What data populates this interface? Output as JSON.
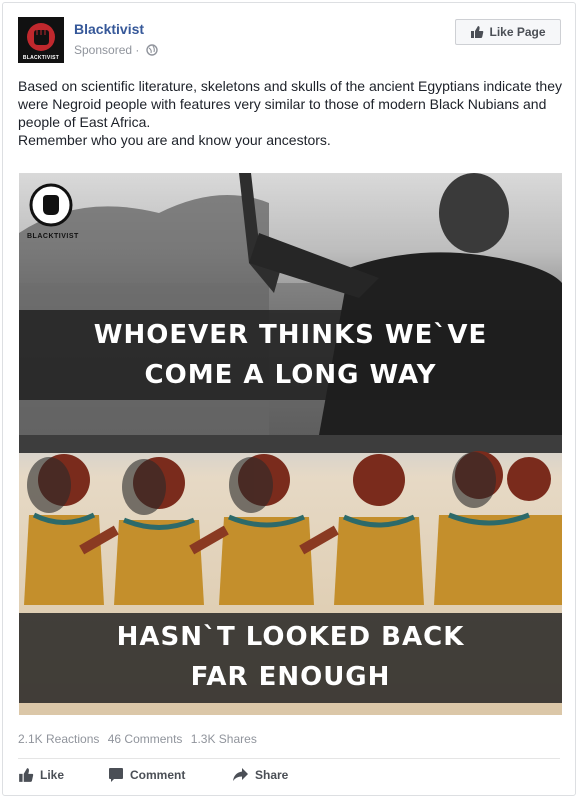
{
  "page": {
    "name": "Blacktivist",
    "sponsored_label": "Sponsored ·",
    "avatar_label": "BLACKTIVIST",
    "like_page_label": "Like Page"
  },
  "post": {
    "text_lines": [
      "Based on scientific literature, skeletons and skulls of the ancient Egyptians indicate they were Negroid people with features very similar to those of modern Black Nubians and people of East Africa.",
      "Remember who you are and know your ancestors."
    ]
  },
  "image": {
    "watermark": "BLACKTIVIST",
    "top_caption": [
      "WHOEVER THINKS WE`VE",
      "COME A LONG WAY"
    ],
    "bottom_caption": [
      "HASN`T LOOKED BACK",
      "FAR ENOUGH"
    ]
  },
  "stats": {
    "reactions": "2.1K Reactions",
    "comments": "46 Comments",
    "shares": "1.3K Shares"
  },
  "actions": {
    "like": "Like",
    "comment": "Comment",
    "share": "Share"
  },
  "colors": {
    "page_name": "#365899",
    "meta_text": "#90949c",
    "action_text": "#4b4f56"
  }
}
